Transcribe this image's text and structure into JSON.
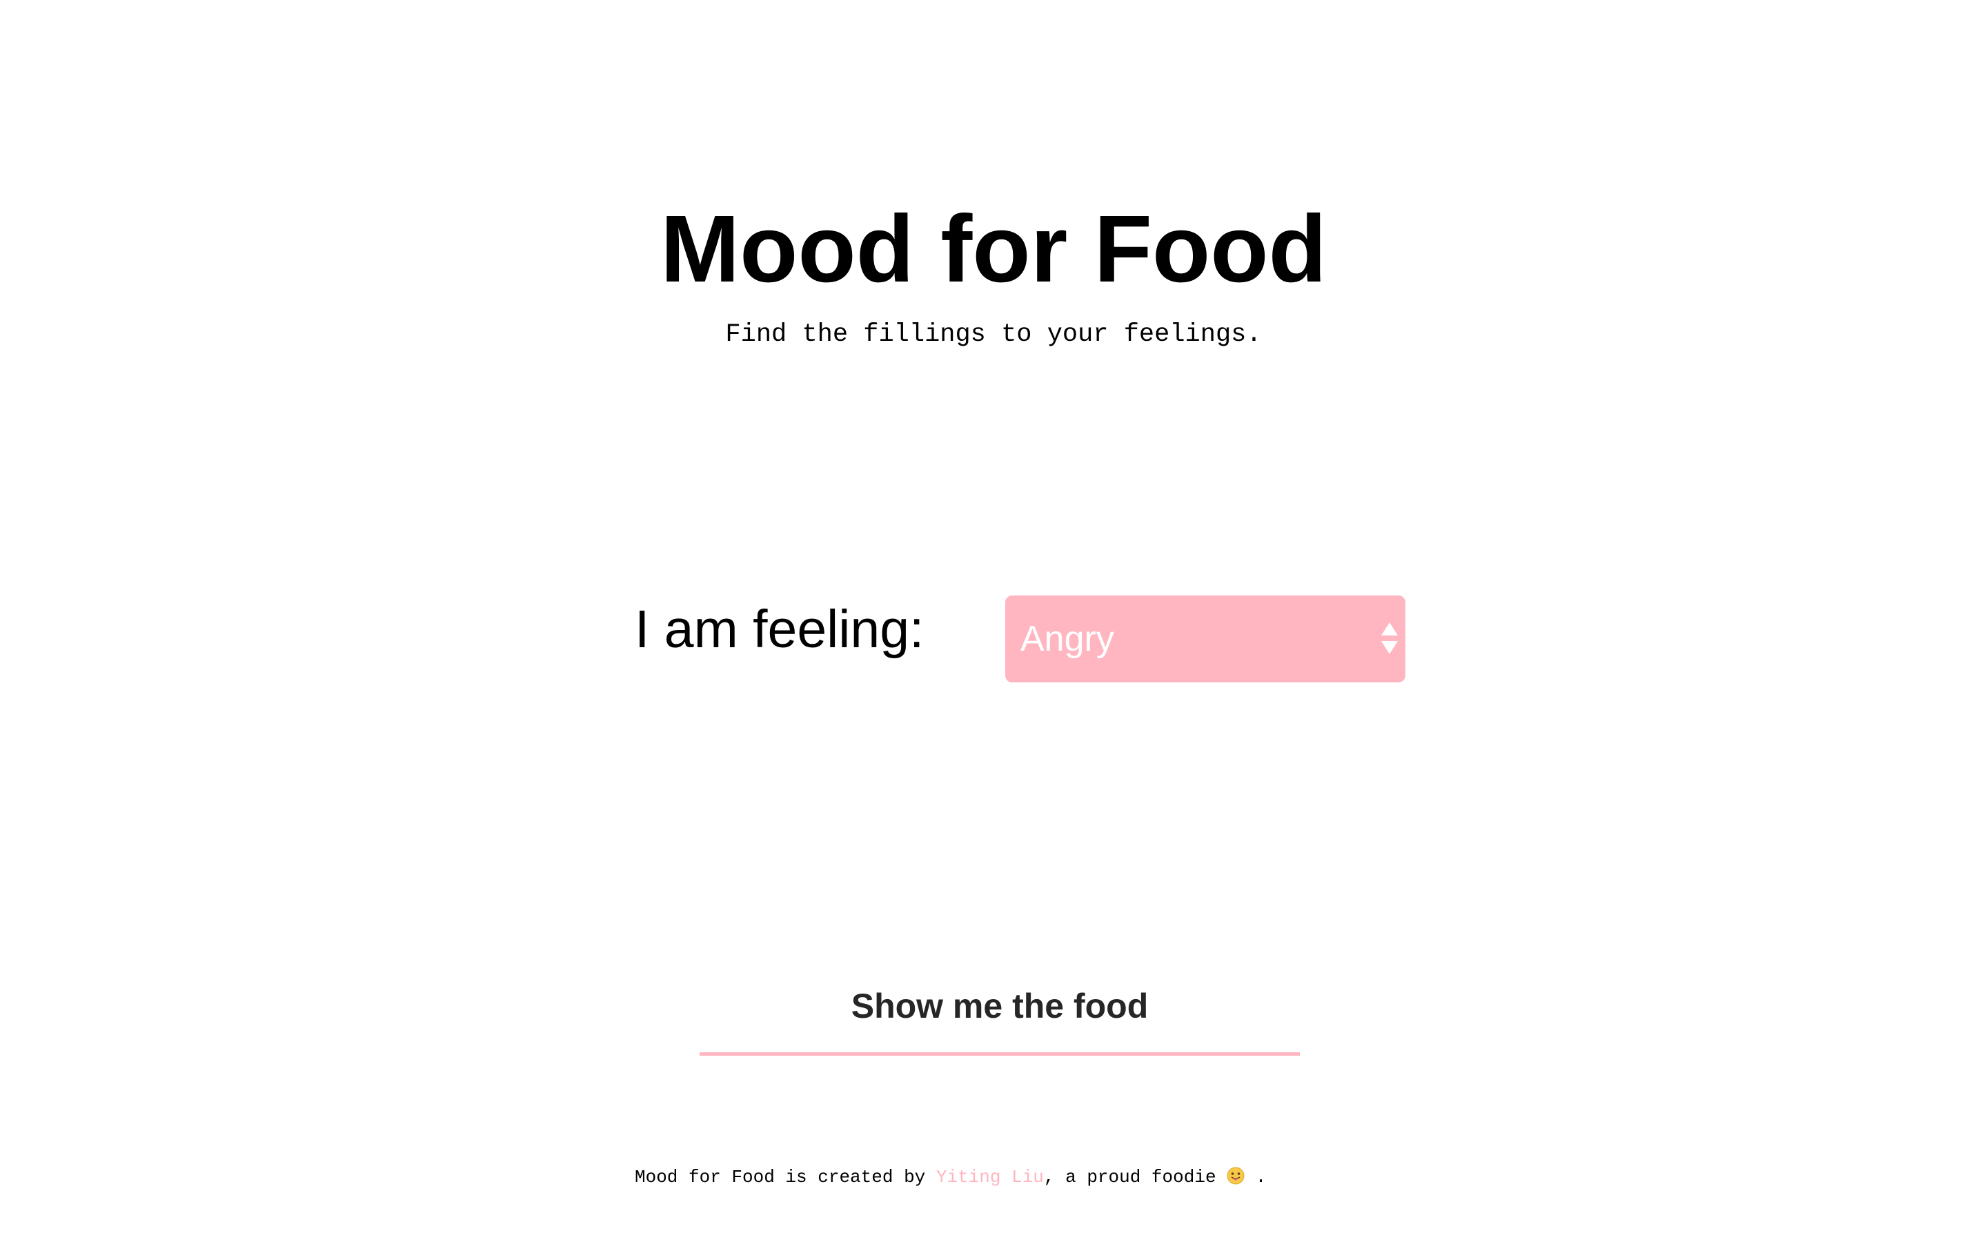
{
  "header": {
    "title": "Mood for Food",
    "tagline": "Find the fillings to your feelings."
  },
  "form": {
    "feeling_label": "I am feeling:",
    "mood_select": {
      "selected": "Angry",
      "icon": "stepper-arrows-icon"
    },
    "submit_label": "Show me the food"
  },
  "footer": {
    "prefix": "Mood for Food is created by ",
    "author_link": "Yiting Liu",
    "middle": ", a proud foodie ",
    "emoji_icon": "tongue-out-face-icon",
    "suffix": " ."
  },
  "colors": {
    "accent": "#ffb6c1",
    "text": "#000000",
    "button_text": "#262626",
    "background": "#ffffff"
  }
}
